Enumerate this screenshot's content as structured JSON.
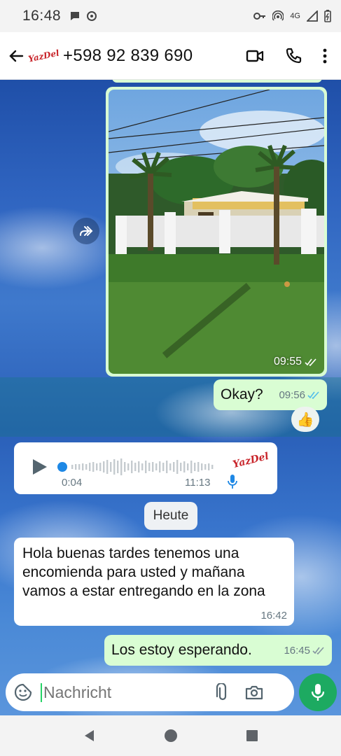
{
  "status_bar": {
    "time": "16:48",
    "network": "4G"
  },
  "header": {
    "contact": "+598 92 839 690",
    "avatar_text": "YazDel",
    "icons": [
      "back-arrow-icon",
      "video-call-icon",
      "phone-icon",
      "more-vert-icon"
    ]
  },
  "messages": {
    "photo": {
      "time": "09:55",
      "status": "read"
    },
    "okay": {
      "text": "Okay?",
      "time": "09:56",
      "reaction": "👍"
    },
    "voice": {
      "duration": "0:04",
      "time": "11:13",
      "sender_logo": "YazDel"
    },
    "date_chip": "Heute",
    "incoming": {
      "text": "Hola buenas tardes tenemos una encomienda para usted y mañana vamos a estar entregando en la zona",
      "time": "16:42"
    },
    "outgoing": {
      "text": "Los estoy esperando.",
      "time": "16:45"
    }
  },
  "input": {
    "placeholder": "Nachricht"
  },
  "colors": {
    "outgoing_bubble": "#d9fdd3",
    "incoming_bubble": "#ffffff",
    "mic_button": "#1daa61",
    "read_ticks": "#53bdeb"
  }
}
